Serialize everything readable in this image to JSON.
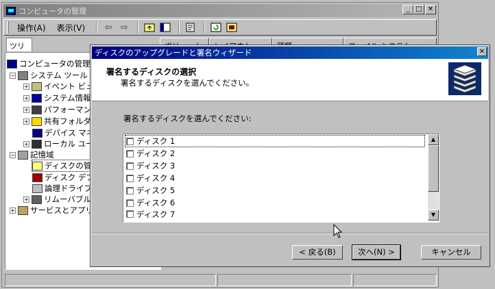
{
  "main_window": {
    "title": "コンピュータの管理",
    "menu": [
      "操作(A)",
      "表示(V)"
    ],
    "tree_tab": "ツリー",
    "tree": [
      {
        "label": "コンピュータの管理 (ロ",
        "level": 0
      },
      {
        "label": "システム ツール",
        "level": 1
      },
      {
        "label": "イベント ビュー",
        "level": 2
      },
      {
        "label": "システム情報",
        "level": 2
      },
      {
        "label": "パフォーマンス",
        "level": 2
      },
      {
        "label": "共有フォルダ",
        "level": 2
      },
      {
        "label": "デバイス マネ",
        "level": 2
      },
      {
        "label": "ローカル ユー",
        "level": 2
      },
      {
        "label": "記憶域",
        "level": 1
      },
      {
        "label": "ディスクの管理",
        "level": 2
      },
      {
        "label": "ディスク デフラ",
        "level": 2
      },
      {
        "label": "論理ドライブ",
        "level": 2
      },
      {
        "label": "リムーバブル記",
        "level": 2
      },
      {
        "label": "サービスとアプリケーション",
        "level": 1
      }
    ],
    "columns": [
      "ボリューム",
      "レイアウト",
      "種類",
      "ファイル システム"
    ]
  },
  "wizard": {
    "title": "ディスクのアップグレードと署名ウィザード",
    "heading": "署名するディスクの選択",
    "subheading": "署名するディスクを選んでください。",
    "prompt": "署名するディスクを選んでください:",
    "disks": [
      "ディスク 1",
      "ディスク 2",
      "ディスク 3",
      "ディスク 4",
      "ディスク 5",
      "ディスク 6",
      "ディスク 7"
    ],
    "buttons": {
      "back": "< 戻る(B)",
      "next": "次へ(N) >",
      "cancel": "キャンセル"
    }
  }
}
